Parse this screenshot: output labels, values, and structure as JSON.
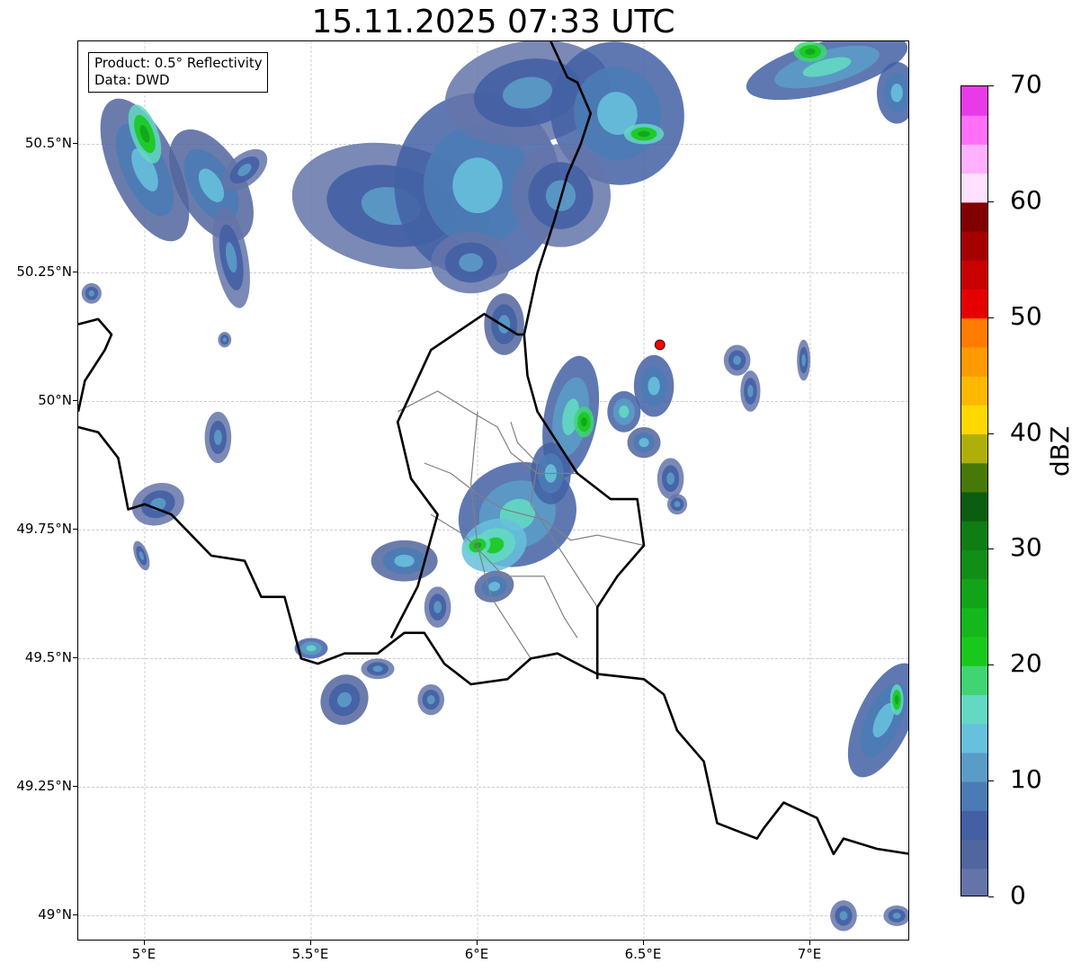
{
  "title": "15.11.2025 07:33 UTC",
  "info_box": {
    "product": "Product: 0.5° Reflectivity",
    "data": "Data: DWD"
  },
  "map": {
    "projection": "plate carree",
    "lon_range": [
      4.8,
      7.3
    ],
    "lat_range": [
      48.95,
      50.7
    ],
    "lat_ticks": [
      {
        "value": 50.5,
        "label": "50.5°N"
      },
      {
        "value": 50.25,
        "label": "50.25°N"
      },
      {
        "value": 50.0,
        "label": "50°N"
      },
      {
        "value": 49.75,
        "label": "49.75°N"
      },
      {
        "value": 49.5,
        "label": "49.5°N"
      },
      {
        "value": 49.25,
        "label": "49.25°N"
      },
      {
        "value": 49.0,
        "label": "49°N"
      }
    ],
    "lon_ticks": [
      {
        "value": 5.0,
        "label": "5°E"
      },
      {
        "value": 5.5,
        "label": "5.5°E"
      },
      {
        "value": 6.0,
        "label": "6°E"
      },
      {
        "value": 6.5,
        "label": "6.5°E"
      },
      {
        "value": 7.0,
        "label": "7°E"
      }
    ],
    "gridlines": true,
    "radar_site": {
      "lon": 6.548,
      "lat": 50.11,
      "color": "#ff0000"
    },
    "country_borders": [
      [
        [
          4.8,
          50.15
        ],
        [
          4.86,
          50.16
        ],
        [
          4.9,
          50.13
        ],
        [
          4.88,
          50.1
        ],
        [
          4.82,
          50.04
        ],
        [
          4.8,
          49.98
        ]
      ],
      [
        [
          4.8,
          49.95
        ],
        [
          4.86,
          49.94
        ],
        [
          4.92,
          49.89
        ],
        [
          4.95,
          49.79
        ],
        [
          5.0,
          49.8
        ],
        [
          5.08,
          49.78
        ],
        [
          5.2,
          49.7
        ],
        [
          5.3,
          49.69
        ],
        [
          5.35,
          49.62
        ],
        [
          5.42,
          49.62
        ],
        [
          5.47,
          49.5
        ],
        [
          5.52,
          49.49
        ],
        [
          5.6,
          49.51
        ],
        [
          5.7,
          49.51
        ],
        [
          5.78,
          49.55
        ],
        [
          5.84,
          49.55
        ],
        [
          5.9,
          49.49
        ],
        [
          5.98,
          49.45
        ],
        [
          6.09,
          49.46
        ],
        [
          6.16,
          49.5
        ],
        [
          6.24,
          49.51
        ],
        [
          6.36,
          49.47
        ],
        [
          6.5,
          49.46
        ],
        [
          6.56,
          49.43
        ],
        [
          6.6,
          49.36
        ],
        [
          6.68,
          49.3
        ],
        [
          6.72,
          49.18
        ],
        [
          6.8,
          49.16
        ],
        [
          6.84,
          49.15
        ],
        [
          6.86,
          49.17
        ],
        [
          6.92,
          49.22
        ],
        [
          7.02,
          49.19
        ],
        [
          7.07,
          49.12
        ],
        [
          7.1,
          49.15
        ],
        [
          7.2,
          49.13
        ],
        [
          7.3,
          49.12
        ]
      ],
      [
        [
          5.74,
          49.54
        ],
        [
          5.82,
          49.64
        ],
        [
          5.88,
          49.78
        ],
        [
          5.8,
          49.85
        ],
        [
          5.76,
          49.96
        ],
        [
          5.86,
          50.1
        ],
        [
          6.02,
          50.17
        ],
        [
          6.12,
          50.13
        ],
        [
          6.14,
          50.13
        ],
        [
          6.15,
          50.05
        ],
        [
          6.18,
          49.98
        ],
        [
          6.3,
          49.86
        ],
        [
          6.4,
          49.81
        ],
        [
          6.48,
          49.81
        ],
        [
          6.5,
          49.72
        ],
        [
          6.42,
          49.66
        ],
        [
          6.36,
          49.6
        ],
        [
          6.36,
          49.46
        ]
      ],
      [
        [
          6.14,
          50.13
        ],
        [
          6.18,
          50.25
        ],
        [
          6.23,
          50.35
        ],
        [
          6.27,
          50.44
        ],
        [
          6.31,
          50.5
        ],
        [
          6.34,
          50.56
        ],
        [
          6.3,
          50.62
        ],
        [
          6.27,
          50.63
        ],
        [
          6.22,
          50.7
        ]
      ]
    ],
    "region_borders": [
      [
        [
          5.76,
          49.98
        ],
        [
          5.88,
          50.02
        ],
        [
          5.98,
          49.98
        ],
        [
          6.06,
          49.95
        ],
        [
          6.1,
          49.9
        ],
        [
          6.18,
          49.86
        ],
        [
          6.3,
          49.86
        ]
      ],
      [
        [
          5.84,
          49.88
        ],
        [
          5.92,
          49.86
        ],
        [
          6.0,
          49.82
        ],
        [
          6.08,
          49.79
        ],
        [
          6.2,
          49.77
        ],
        [
          6.28,
          49.73
        ],
        [
          6.36,
          49.74
        ],
        [
          6.5,
          49.72
        ]
      ],
      [
        [
          6.0,
          49.98
        ],
        [
          5.98,
          49.84
        ],
        [
          6.0,
          49.72
        ],
        [
          6.04,
          49.62
        ],
        [
          6.1,
          49.56
        ],
        [
          6.16,
          49.5
        ]
      ],
      [
        [
          5.86,
          49.78
        ],
        [
          5.96,
          49.74
        ],
        [
          6.02,
          49.7
        ],
        [
          6.08,
          49.66
        ],
        [
          6.2,
          49.66
        ],
        [
          6.26,
          49.58
        ],
        [
          6.3,
          49.54
        ]
      ],
      [
        [
          6.1,
          49.96
        ],
        [
          6.12,
          49.92
        ],
        [
          6.18,
          49.88
        ],
        [
          6.16,
          49.8
        ],
        [
          6.22,
          49.74
        ],
        [
          6.28,
          49.68
        ],
        [
          6.36,
          49.6
        ]
      ]
    ]
  },
  "colorbar": {
    "label": "dBZ",
    "min": 0,
    "max": 70,
    "ticks": [
      {
        "value": 70,
        "label": "70"
      },
      {
        "value": 60,
        "label": "60"
      },
      {
        "value": 50,
        "label": "50"
      },
      {
        "value": 40,
        "label": "40"
      },
      {
        "value": 30,
        "label": "30"
      },
      {
        "value": 20,
        "label": "20"
      },
      {
        "value": 10,
        "label": "10"
      },
      {
        "value": 0,
        "label": "0"
      }
    ],
    "bands": [
      {
        "from": 0,
        "to": 2.5,
        "color": "#6474a9"
      },
      {
        "from": 2.5,
        "to": 5,
        "color": "#51659e"
      },
      {
        "from": 5,
        "to": 7.5,
        "color": "#4360a4"
      },
      {
        "from": 7.5,
        "to": 10,
        "color": "#4b7bb5"
      },
      {
        "from": 10,
        "to": 12.5,
        "color": "#5b9bc8"
      },
      {
        "from": 12.5,
        "to": 15,
        "color": "#67c0dc"
      },
      {
        "from": 15,
        "to": 17.5,
        "color": "#63d8c2"
      },
      {
        "from": 17.5,
        "to": 20,
        "color": "#3fd573"
      },
      {
        "from": 20,
        "to": 22.5,
        "color": "#18c91c"
      },
      {
        "from": 22.5,
        "to": 25,
        "color": "#14b81a"
      },
      {
        "from": 25,
        "to": 27.5,
        "color": "#12a418"
      },
      {
        "from": 27.5,
        "to": 30,
        "color": "#108e16"
      },
      {
        "from": 30,
        "to": 32.5,
        "color": "#0f7c14"
      },
      {
        "from": 32.5,
        "to": 35,
        "color": "#0a5e0d"
      },
      {
        "from": 35,
        "to": 37.5,
        "color": "#487808"
      },
      {
        "from": 37.5,
        "to": 40,
        "color": "#aeb009"
      },
      {
        "from": 40,
        "to": 42.5,
        "color": "#ffd800"
      },
      {
        "from": 42.5,
        "to": 45,
        "color": "#ffb800"
      },
      {
        "from": 45,
        "to": 47.5,
        "color": "#ff9a00"
      },
      {
        "from": 47.5,
        "to": 50,
        "color": "#ff7c00"
      },
      {
        "from": 50,
        "to": 52.5,
        "color": "#e60000"
      },
      {
        "from": 52.5,
        "to": 55,
        "color": "#c80000"
      },
      {
        "from": 55,
        "to": 57.5,
        "color": "#a40000"
      },
      {
        "from": 57.5,
        "to": 60,
        "color": "#800000"
      },
      {
        "from": 60,
        "to": 62.5,
        "color": "#ffe0ff"
      },
      {
        "from": 62.5,
        "to": 65,
        "color": "#ffb0ff"
      },
      {
        "from": 65,
        "to": 67.5,
        "color": "#ff70f6"
      },
      {
        "from": 67.5,
        "to": 70,
        "color": "#e83ae8"
      }
    ]
  },
  "echoes": [
    {
      "lon": 5.0,
      "lat": 50.45,
      "rx": 0.1,
      "ry": 0.15,
      "rot": -25,
      "dbz": 8
    },
    {
      "lon": 5.0,
      "lat": 50.52,
      "rx": 0.04,
      "ry": 0.06,
      "rot": -20,
      "dbz": 20
    },
    {
      "lon": 5.2,
      "lat": 50.42,
      "rx": 0.1,
      "ry": 0.12,
      "rot": -30,
      "dbz": 8
    },
    {
      "lon": 5.26,
      "lat": 50.28,
      "rx": 0.05,
      "ry": 0.1,
      "rot": -10,
      "dbz": 6
    },
    {
      "lon": 5.3,
      "lat": 50.45,
      "rx": 0.08,
      "ry": 0.03,
      "rot": -40,
      "dbz": 5
    },
    {
      "lon": 4.84,
      "lat": 50.21,
      "rx": 0.03,
      "ry": 0.02,
      "rot": 0,
      "dbz": 6
    },
    {
      "lon": 5.24,
      "lat": 50.12,
      "rx": 0.02,
      "ry": 0.015,
      "rot": 0,
      "dbz": 5
    },
    {
      "lon": 5.22,
      "lat": 49.93,
      "rx": 0.04,
      "ry": 0.05,
      "rot": 0,
      "dbz": 5
    },
    {
      "lon": 5.04,
      "lat": 49.8,
      "rx": 0.08,
      "ry": 0.04,
      "rot": -20,
      "dbz": 6
    },
    {
      "lon": 4.99,
      "lat": 49.7,
      "rx": 0.02,
      "ry": 0.03,
      "rot": -20,
      "dbz": 5
    },
    {
      "lon": 5.74,
      "lat": 50.38,
      "rx": 0.3,
      "ry": 0.12,
      "rot": 10,
      "dbz": 6
    },
    {
      "lon": 6.0,
      "lat": 50.42,
      "rx": 0.25,
      "ry": 0.18,
      "rot": 0,
      "dbz": 9
    },
    {
      "lon": 6.15,
      "lat": 50.6,
      "rx": 0.25,
      "ry": 0.1,
      "rot": -10,
      "dbz": 5
    },
    {
      "lon": 6.42,
      "lat": 50.56,
      "rx": 0.2,
      "ry": 0.14,
      "rot": -15,
      "dbz": 9
    },
    {
      "lon": 6.5,
      "lat": 50.52,
      "rx": 0.06,
      "ry": 0.02,
      "rot": 0,
      "dbz": 20
    },
    {
      "lon": 6.25,
      "lat": 50.4,
      "rx": 0.15,
      "ry": 0.1,
      "rot": 0,
      "dbz": 6
    },
    {
      "lon": 5.98,
      "lat": 50.27,
      "rx": 0.12,
      "ry": 0.06,
      "rot": 0,
      "dbz": 5
    },
    {
      "lon": 6.08,
      "lat": 50.15,
      "rx": 0.06,
      "ry": 0.06,
      "rot": 0,
      "dbz": 7
    },
    {
      "lon": 7.05,
      "lat": 50.65,
      "rx": 0.25,
      "ry": 0.05,
      "rot": -15,
      "dbz": 10
    },
    {
      "lon": 7.0,
      "lat": 50.68,
      "rx": 0.05,
      "ry": 0.02,
      "rot": 0,
      "dbz": 22
    },
    {
      "lon": 7.26,
      "lat": 50.6,
      "rx": 0.06,
      "ry": 0.06,
      "rot": 0,
      "dbz": 9
    },
    {
      "lon": 6.28,
      "lat": 49.97,
      "rx": 0.08,
      "ry": 0.12,
      "rot": 10,
      "dbz": 10
    },
    {
      "lon": 6.32,
      "lat": 49.96,
      "rx": 0.03,
      "ry": 0.03,
      "rot": 0,
      "dbz": 22
    },
    {
      "lon": 6.44,
      "lat": 49.98,
      "rx": 0.05,
      "ry": 0.04,
      "rot": 0,
      "dbz": 10
    },
    {
      "lon": 6.53,
      "lat": 50.03,
      "rx": 0.06,
      "ry": 0.06,
      "rot": 0,
      "dbz": 9
    },
    {
      "lon": 6.5,
      "lat": 49.92,
      "rx": 0.05,
      "ry": 0.03,
      "rot": 0,
      "dbz": 8
    },
    {
      "lon": 6.58,
      "lat": 49.85,
      "rx": 0.04,
      "ry": 0.04,
      "rot": 0,
      "dbz": 6
    },
    {
      "lon": 6.6,
      "lat": 49.8,
      "rx": 0.03,
      "ry": 0.02,
      "rot": 0,
      "dbz": 5
    },
    {
      "lon": 6.78,
      "lat": 50.08,
      "rx": 0.04,
      "ry": 0.03,
      "rot": 0,
      "dbz": 5
    },
    {
      "lon": 6.82,
      "lat": 50.02,
      "rx": 0.03,
      "ry": 0.04,
      "rot": 0,
      "dbz": 5
    },
    {
      "lon": 6.98,
      "lat": 50.08,
      "rx": 0.02,
      "ry": 0.04,
      "rot": 0,
      "dbz": 5
    },
    {
      "lon": 6.12,
      "lat": 49.78,
      "rx": 0.18,
      "ry": 0.1,
      "rot": -20,
      "dbz": 11
    },
    {
      "lon": 6.05,
      "lat": 49.72,
      "rx": 0.1,
      "ry": 0.05,
      "rot": -20,
      "dbz": 17
    },
    {
      "lon": 6.0,
      "lat": 49.72,
      "rx": 0.04,
      "ry": 0.02,
      "rot": -20,
      "dbz": 21
    },
    {
      "lon": 6.05,
      "lat": 49.64,
      "rx": 0.06,
      "ry": 0.03,
      "rot": -15,
      "dbz": 8
    },
    {
      "lon": 5.78,
      "lat": 49.69,
      "rx": 0.1,
      "ry": 0.04,
      "rot": 0,
      "dbz": 8
    },
    {
      "lon": 6.22,
      "lat": 49.86,
      "rx": 0.06,
      "ry": 0.06,
      "rot": 0,
      "dbz": 9
    },
    {
      "lon": 5.88,
      "lat": 49.6,
      "rx": 0.04,
      "ry": 0.04,
      "rot": 0,
      "dbz": 6
    },
    {
      "lon": 5.5,
      "lat": 49.52,
      "rx": 0.05,
      "ry": 0.02,
      "rot": 0,
      "dbz": 10
    },
    {
      "lon": 5.6,
      "lat": 49.42,
      "rx": 0.07,
      "ry": 0.05,
      "rot": 30,
      "dbz": 7
    },
    {
      "lon": 5.7,
      "lat": 49.48,
      "rx": 0.05,
      "ry": 0.02,
      "rot": 0,
      "dbz": 6
    },
    {
      "lon": 5.86,
      "lat": 49.42,
      "rx": 0.04,
      "ry": 0.03,
      "rot": 0,
      "dbz": 6
    },
    {
      "lon": 7.22,
      "lat": 49.38,
      "rx": 0.08,
      "ry": 0.12,
      "rot": 25,
      "dbz": 9
    },
    {
      "lon": 7.26,
      "lat": 49.42,
      "rx": 0.02,
      "ry": 0.03,
      "rot": 0,
      "dbz": 20
    },
    {
      "lon": 7.1,
      "lat": 49.0,
      "rx": 0.04,
      "ry": 0.03,
      "rot": 0,
      "dbz": 6
    },
    {
      "lon": 7.26,
      "lat": 49.0,
      "rx": 0.04,
      "ry": 0.02,
      "rot": 0,
      "dbz": 6
    }
  ]
}
